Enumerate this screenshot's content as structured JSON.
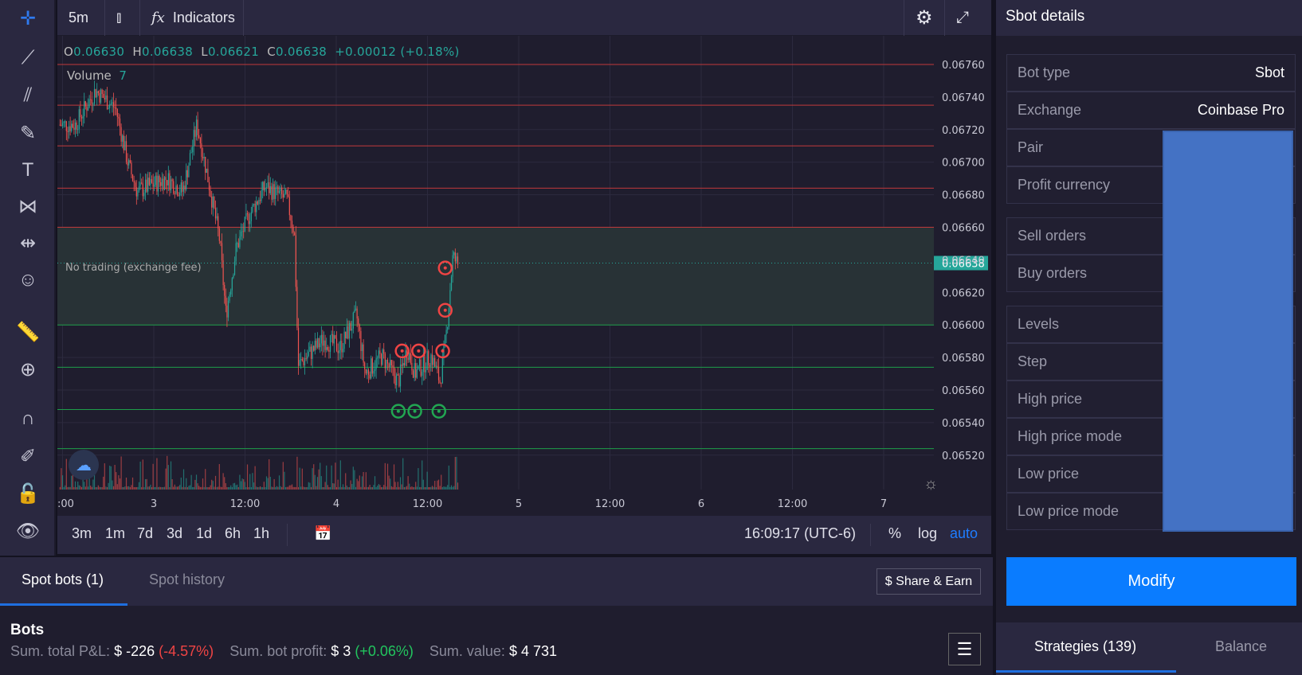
{
  "toolbar": {
    "interval": "5m",
    "indicators": "Indicators",
    "left_tools": [
      "crosshair-icon",
      "trend-line-icon",
      "fib-icon",
      "brush-icon",
      "text-icon",
      "pattern-icon",
      "measure-lines-icon",
      "emoji-icon",
      "ruler-icon",
      "zoom-in-icon",
      "magnet-icon",
      "lock-drawing-icon",
      "unlock-icon",
      "eye-icon"
    ]
  },
  "legend": {
    "o_label": "O",
    "o": "0.06630",
    "h_label": "H",
    "h": "0.06638",
    "l_label": "L",
    "l": "0.06621",
    "c_label": "C",
    "c": "0.06638",
    "change": "+0.00012 (+0.18%)",
    "volume_label": "Volume",
    "volume": "7"
  },
  "chart_data": {
    "type": "candlestick",
    "y_ticks": [
      "0.06760",
      "0.06740",
      "0.06720",
      "0.06700",
      "0.06680",
      "0.06660",
      "0.06640",
      "0.06620",
      "0.06600",
      "0.06580",
      "0.06560",
      "0.06540",
      "0.06520"
    ],
    "x_ticks": [
      ":00",
      "3",
      "12:00",
      "4",
      "12:00",
      "5",
      "12:00",
      "6",
      "12:00",
      "7"
    ],
    "ylim": [
      0.0651,
      0.06775
    ],
    "current_price": "0.06638",
    "zone_label": "No trading (exchange fee)",
    "zone": [
      0.066,
      0.0666
    ],
    "sell_levels": [
      0.0676,
      0.06735,
      0.0671,
      0.06684,
      0.0666
    ],
    "buy_levels": [
      0.066,
      0.06574,
      0.06548,
      0.06524
    ],
    "price_path": [
      [
        "2 11:40",
        0.06723
      ],
      [
        "2 13:40",
        0.06723
      ],
      [
        "2 16:20",
        0.06744
      ],
      [
        "2 19:00",
        0.06733
      ],
      [
        "2 20:40",
        0.06698
      ],
      [
        "2 21:50",
        0.06682
      ],
      [
        "3 01:40",
        0.0669
      ],
      [
        "3 03:50",
        0.06682
      ],
      [
        "3 05:40",
        0.06723
      ],
      [
        "3 07:00",
        0.06693
      ],
      [
        "3 08:40",
        0.06652
      ],
      [
        "3 09:30",
        0.06606
      ],
      [
        "3 10:50",
        0.06647
      ],
      [
        "3 12:30",
        0.06667
      ],
      [
        "3 14:40",
        0.06685
      ],
      [
        "3 17:30",
        0.06677
      ],
      [
        "3 18:30",
        0.06657
      ],
      [
        "3 19:00",
        0.06575
      ],
      [
        "3 20:10",
        0.06581
      ],
      [
        "3 22:20",
        0.06591
      ],
      [
        "4 00:30",
        0.06586
      ],
      [
        "4 02:40",
        0.06606
      ],
      [
        "4 03:50",
        0.0657
      ],
      [
        "4 06:00",
        0.06581
      ],
      [
        "4 08:10",
        0.06565
      ],
      [
        "4 09:20",
        0.06586
      ],
      [
        "4 10:20",
        0.0657
      ],
      [
        "4 12:30",
        0.06581
      ],
      [
        "4 13:40",
        0.06565
      ],
      [
        "4 14:30",
        0.06596
      ],
      [
        "4 15:20",
        0.06642
      ],
      [
        "4 16:00",
        0.06637
      ]
    ],
    "sell_markers": [
      [
        "4 14:20",
        0.06635
      ],
      [
        "4 14:20",
        0.06609
      ],
      [
        "4 08:40",
        0.06584
      ],
      [
        "4 10:50",
        0.06584
      ],
      [
        "4 14:00",
        0.06584
      ]
    ],
    "buy_markers": [
      [
        "4 08:10",
        0.06547
      ],
      [
        "4 10:20",
        0.06547
      ],
      [
        "4 13:30",
        0.06547
      ]
    ],
    "colors": {
      "up": "#26a69a",
      "down": "#ef5350",
      "sell_line": "#c0393b",
      "buy_line": "#1e9e4a",
      "current": "#26a69a"
    }
  },
  "bottom_toolbar": {
    "ranges": [
      "3m",
      "1m",
      "7d",
      "3d",
      "1d",
      "6h",
      "1h"
    ],
    "clock": "16:09:17 (UTC-6)",
    "percent": "%",
    "log": "log",
    "auto": "auto"
  },
  "bottom": {
    "tabs": [
      "Spot bots (1)",
      "Spot history"
    ],
    "share": "$ Share & Earn",
    "bots_title": "Bots",
    "pnl_label": "Sum. total P&L:",
    "pnl": "$ -226",
    "pnl_pct": "(-4.57%)",
    "profit_label": "Sum. bot profit:",
    "profit": "$ 3",
    "profit_pct": "(+0.06%)",
    "value_label": "Sum. value:",
    "value": "$ 4 731"
  },
  "details": {
    "title": "Sbot details",
    "rows": [
      {
        "label": "Bot type",
        "value": "Sbot"
      },
      {
        "label": "Exchange",
        "value": "Coinbase Pro"
      },
      {
        "label": "Pair"
      },
      {
        "label": "Profit currency"
      },
      {
        "label": "Sell orders"
      },
      {
        "label": "Buy orders"
      },
      {
        "label": "Levels"
      },
      {
        "label": "Step"
      },
      {
        "label": "High price"
      },
      {
        "label": "High price mode"
      },
      {
        "label": "Low price"
      },
      {
        "label": "Low price mode"
      }
    ],
    "modify": "Modify",
    "tabs": [
      "Strategies (139)",
      "Balance"
    ]
  }
}
